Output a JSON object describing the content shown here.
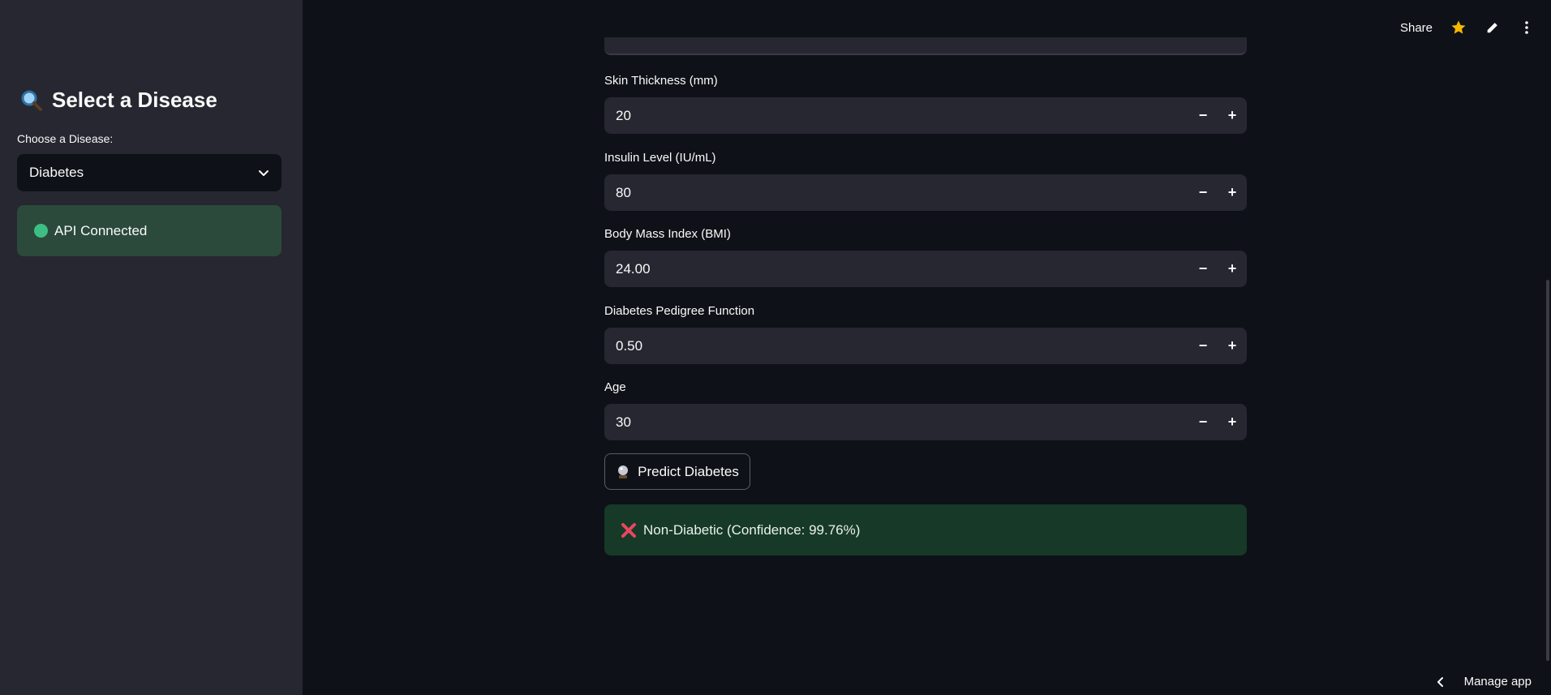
{
  "sidebar": {
    "title": "Select a Disease",
    "title_icon": "magnifier-icon",
    "select_label": "Choose a Disease:",
    "select_value": "Diabetes",
    "api_status": "API Connected",
    "api_status_color": "#3dbf83"
  },
  "topbar": {
    "share_label": "Share",
    "icons": [
      "star-icon",
      "edit-icon",
      "more-icon"
    ],
    "star_color": "#f5b700"
  },
  "form": {
    "fields": [
      {
        "label": "Skin Thickness (mm)",
        "value": "20"
      },
      {
        "label": "Insulin Level (IU/mL)",
        "value": "80"
      },
      {
        "label": "Body Mass Index (BMI)",
        "value": "24.00"
      },
      {
        "label": "Diabetes Pedigree Function",
        "value": "0.50"
      },
      {
        "label": "Age",
        "value": "30"
      }
    ],
    "stepper_minus": "−",
    "stepper_plus": "+"
  },
  "predict_button": {
    "label": "Predict Diabetes",
    "icon": "crystal-ball-icon"
  },
  "result": {
    "text": "Non-Diabetic (Confidence: 99.76%)",
    "icon": "cross-mark-icon",
    "icon_color": "#e8475f",
    "background": "#173928"
  },
  "footer": {
    "manage_label": "Manage app"
  }
}
